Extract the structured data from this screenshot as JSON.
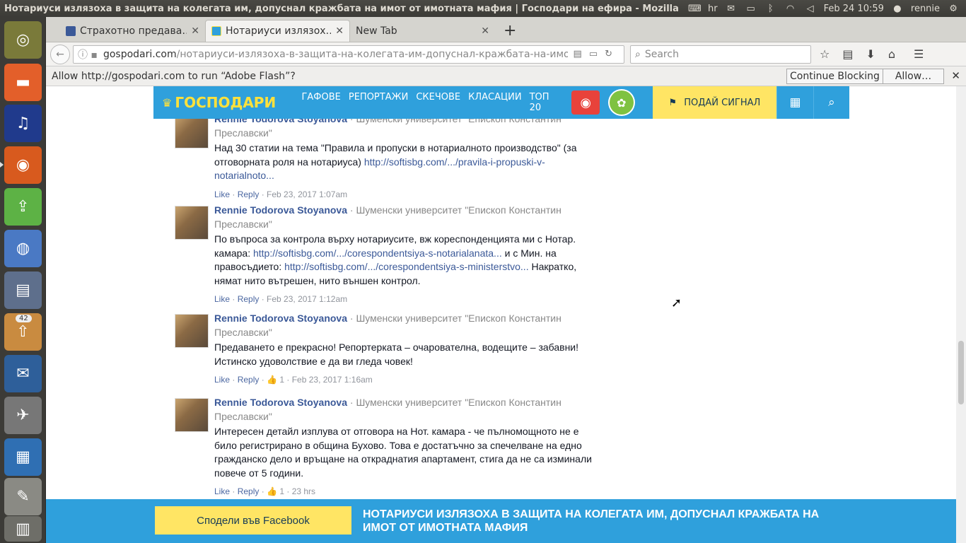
{
  "panel": {
    "window_title": "Нотариуси излязоха в защита на колегата им, допуснал кражбата на имот от имотната мафия | Господари на ефира - Mozilla Firef",
    "keyboard": "hr",
    "datetime": "Feb 24 10:59",
    "user": "rennie"
  },
  "launcher": {
    "badge_count": "42",
    "items": [
      "ubuntu-dash",
      "files",
      "audacity",
      "firefox",
      "software-updater",
      "chromium",
      "pdf-viewer",
      "archive-manager",
      "thunderbird",
      "inkscape",
      "libreoffice-writer",
      "text-editor",
      "trash"
    ]
  },
  "tabs": [
    {
      "label": "Страхотно предава…",
      "favicon_color": "#3b5998"
    },
    {
      "label": "Нотариуси излязох…",
      "favicon_color": "#2fa0dc"
    },
    {
      "label": "New Tab",
      "favicon_color": ""
    }
  ],
  "nav": {
    "url_host": "gospodari.com",
    "url_path": "/нотариуси-излязоха-в-защита-на-колегата-им-допуснал-кражбата-на-имот-от-имо",
    "search_placeholder": "Search"
  },
  "flash": {
    "message": "Allow http://gospodari.com to run “Adobe Flash”?",
    "continue_label": "Continue Blocking",
    "allow_label": "Allow…"
  },
  "site": {
    "logo": "ГОСПОДАРИ",
    "menu": [
      "ГАФОВЕ",
      "РЕПОРТАЖИ",
      "СКЕЧОВЕ",
      "КЛАСАЦИИ",
      "ТОП 20"
    ],
    "signal_label": "ПОДАЙ СИГНАЛ"
  },
  "comments": [
    {
      "author": "Rennie Todorova Stoyanova",
      "affiliation": " · Шуменски университет \"Епископ Константин Преславски\"",
      "text_before": "Над 30 статии на тема \"Правила и пропуски в нотариалното производство\" (за отговорната роля на нотариуса) ",
      "link1": "http://softisbg.com/.../pravila-i-propuski-v-notarialnoto...",
      "text_mid": "",
      "link2": "",
      "text_after": "",
      "like": "Like",
      "reply": "Reply",
      "likes_count": "",
      "time": "Feb 23, 2017 1:07am"
    },
    {
      "author": "Rennie Todorova Stoyanova",
      "affiliation": " · Шуменски университет \"Епископ Константин Преславски\"",
      "text_before": "По въпроса за контрола върху нотариусите, вж кореспонденцията ми с Нотар. камара: ",
      "link1": "http://softisbg.com/.../corespondentsiya-s-notarialanata...",
      "text_mid": " и с Мин. на правосъдието: ",
      "link2": "http://softisbg.com/.../corespondentsiya-s-ministerstvo...",
      "text_after": " Накратко, нямат нито вътрешен, нито външен контрол.",
      "like": "Like",
      "reply": "Reply",
      "likes_count": "",
      "time": "Feb 23, 2017 1:12am"
    },
    {
      "author": "Rennie Todorova Stoyanova",
      "affiliation": " · Шуменски университет \"Епископ Константин Преславски\"",
      "text_before": "Предаването е прекрасно! Репортерката – очарователна, водещите – забавни! Истинско удоволствие е да ви гледа човек!",
      "link1": "",
      "text_mid": "",
      "link2": "",
      "text_after": "",
      "like": "Like",
      "reply": "Reply",
      "likes_count": "1",
      "time": "Feb 23, 2017 1:16am"
    },
    {
      "author": "Rennie Todorova Stoyanova",
      "affiliation": " · Шуменски университет \"Епископ Константин Преславски\"",
      "text_before": "Интересен детайл изплува от отговора на Нот. камара - че пълномощното не е било регистрирано в община Бухово. Това е достатъчно за спечелване на едно гражданско дело и връщане на откраднатия апартамент, стига да не са изминали повече от 5 години.",
      "link1": "",
      "text_mid": "",
      "link2": "",
      "text_after": "",
      "like": "Like",
      "reply": "Reply",
      "likes_count": "1",
      "time": "23 hrs"
    }
  ],
  "share": {
    "button": "Сподели във Facebook",
    "title": "НОТАРИУСИ ИЗЛЯЗОХА В ЗАЩИТА НА КОЛЕГАТА ИМ, ДОПУСНАЛ КРАЖБАТА НА ИМОТ ОТ ИМОТНАТА МАФИЯ"
  }
}
